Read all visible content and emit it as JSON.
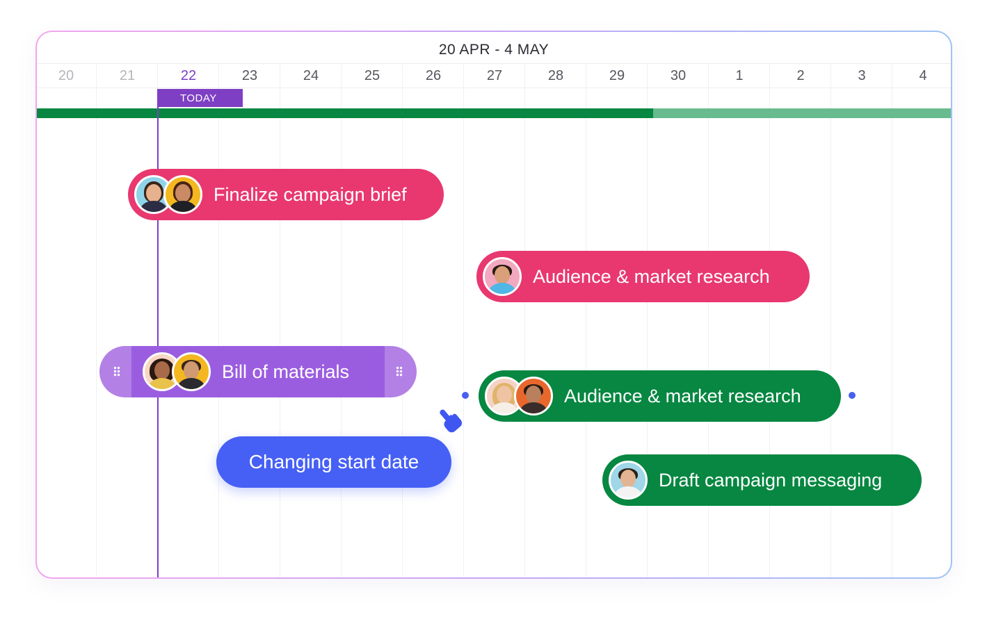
{
  "timeline": {
    "range_title": "20 APR - 4 MAY",
    "days": [
      "20",
      "21",
      "22",
      "23",
      "24",
      "25",
      "26",
      "27",
      "28",
      "29",
      "30",
      "1",
      "2",
      "3",
      "4"
    ],
    "today_label": "TODAY",
    "today_day": "22",
    "progress_fraction": 0.674
  },
  "tasks": [
    {
      "label": "Finalize campaign brief",
      "color": "pink",
      "assignee_count": 2
    },
    {
      "label": "Audience & market research",
      "color": "pink",
      "assignee_count": 1
    },
    {
      "label": "Bill of materials",
      "color": "purple",
      "assignee_count": 2,
      "state": "dragging"
    },
    {
      "label": "Audience & market research",
      "color": "green",
      "assignee_count": 2
    },
    {
      "label": "Draft campaign messaging",
      "color": "green",
      "assignee_count": 1
    }
  ],
  "tooltip": {
    "text": "Changing start date"
  },
  "colors": {
    "pink": "#e8386f",
    "green": "#078741",
    "purple": "#9b5de0",
    "purple_light": "#b380e6",
    "today": "#7e3fc4",
    "tooltip": "#4660f5",
    "progress_done": "#078741",
    "progress_remaining": "#68bb8e"
  },
  "icons": {
    "cursor": "pointing-hand-icon",
    "grip": "drag-grip-icon"
  }
}
